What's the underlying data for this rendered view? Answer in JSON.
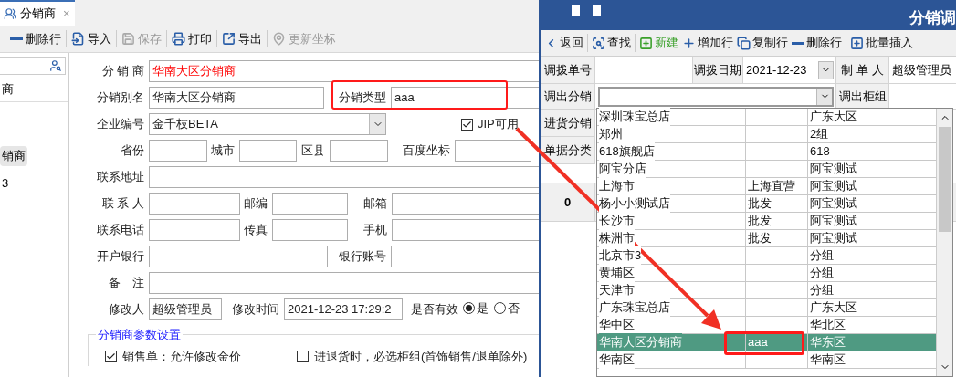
{
  "left_window": {
    "tab": {
      "label": "分销商",
      "close": "×"
    },
    "toolbar": [
      {
        "label": "删除行",
        "kind": "remove",
        "disabled": false
      },
      {
        "label": "导入",
        "kind": "import",
        "disabled": false
      },
      {
        "label": "保存",
        "kind": "save",
        "disabled": true
      },
      {
        "label": "打印",
        "kind": "print",
        "disabled": false
      },
      {
        "label": "导出",
        "kind": "export",
        "disabled": false
      },
      {
        "label": "更新坐标",
        "kind": "pin",
        "disabled": true
      }
    ],
    "sidebar": {
      "items": [
        {
          "label": "商",
          "selected": false
        },
        {
          "label": "销商",
          "selected": true
        },
        {
          "label": "3",
          "selected": false
        }
      ]
    },
    "form": {
      "distributor": {
        "label": "分 销 商",
        "value": "华南大区分销商"
      },
      "alias": {
        "label": "分销别名",
        "value": "华南大区分销商"
      },
      "type": {
        "label": "分销类型",
        "value": "aaa"
      },
      "company": {
        "label": "企业编号",
        "value": "金千枝BETA"
      },
      "jip": {
        "label": "JIP可用",
        "checked": true
      },
      "province": {
        "label": "省份"
      },
      "city": {
        "label": "城市"
      },
      "county": {
        "label": "区县"
      },
      "baidu": {
        "label": "百度坐标"
      },
      "address": {
        "label": "联系地址"
      },
      "contact": {
        "label": "联 系 人"
      },
      "postcode": {
        "label": "邮编"
      },
      "email": {
        "label": "邮箱"
      },
      "phone": {
        "label": "联系电话"
      },
      "fax": {
        "label": "传真"
      },
      "mobile": {
        "label": "手机"
      },
      "bank": {
        "label": "开户银行"
      },
      "account": {
        "label": "银行账号"
      },
      "remark": {
        "label": "备　注"
      },
      "modifier": {
        "label": "修改人",
        "value": "超级管理员"
      },
      "modified": {
        "label": "修改时间",
        "value": "2021-12-23 17:29:2"
      },
      "valid": {
        "label": "是否有效",
        "options": [
          {
            "label": "是",
            "selected": true
          },
          {
            "label": "否",
            "selected": false
          }
        ]
      }
    },
    "params": {
      "title": "分销商参数设置",
      "options": [
        {
          "label": "销售单：允许修改金价",
          "checked": true
        },
        {
          "label": "进退货时，必选柜组(首饰销售/退单除外)",
          "checked": false
        }
      ]
    }
  },
  "right_window": {
    "title": "分销调",
    "toolbar": [
      {
        "label": "返回",
        "kind": "back"
      },
      {
        "label": "查找",
        "kind": "find"
      },
      {
        "label": "新建",
        "kind": "new"
      },
      {
        "label": "增加行",
        "kind": "add"
      },
      {
        "label": "复制行",
        "kind": "copy"
      },
      {
        "label": "删除行",
        "kind": "remove"
      },
      {
        "label": "批量插入",
        "kind": "batch"
      }
    ],
    "form": {
      "number_label": "调拨单号",
      "date_label": "调拨日期",
      "date": "2021-12-23",
      "maker_label": "制 单 人",
      "maker": "超级管理员",
      "out_label": "调出分销",
      "counter_label": "调出柜组",
      "in_label": "进货分销",
      "category_label": "单据分类"
    },
    "grid_row": "0",
    "dropdown": {
      "rows": [
        {
          "name": "深圳珠宝总店",
          "column_3": "广东大区",
          "selected": false
        },
        {
          "name": "郑州",
          "column_3": "2组",
          "selected": false
        },
        {
          "name": "618旗舰店",
          "column_3": "618",
          "selected": false
        },
        {
          "name": "阿宝分店",
          "column_3": "阿宝测试",
          "selected": false
        },
        {
          "name": "上海市",
          "column_2": "上海直营",
          "column_3": "阿宝测试",
          "selected": false
        },
        {
          "name": "杨小小测试店",
          "column_2": "批发",
          "column_3": "阿宝测试",
          "selected": false
        },
        {
          "name": "长沙市",
          "column_2": "批发",
          "column_3": "阿宝测试",
          "selected": false
        },
        {
          "name": "株洲市",
          "column_2": "批发",
          "column_3": "阿宝测试",
          "selected": false
        },
        {
          "name": "北京市3",
          "column_3": "分组",
          "selected": false
        },
        {
          "name": "黄埔区",
          "column_3": "分组",
          "selected": false
        },
        {
          "name": "天津市",
          "column_3": "分组",
          "selected": false
        },
        {
          "name": "广东珠宝总店",
          "column_3": "广东大区",
          "selected": false
        },
        {
          "name": "华中区",
          "column_3": "华北区",
          "selected": false
        },
        {
          "name": "华南大区分销商",
          "column_2": "aaa",
          "column_3": "华东区",
          "selected": true
        },
        {
          "name": "华南区",
          "column_3": "华南区",
          "selected": false
        }
      ]
    }
  }
}
